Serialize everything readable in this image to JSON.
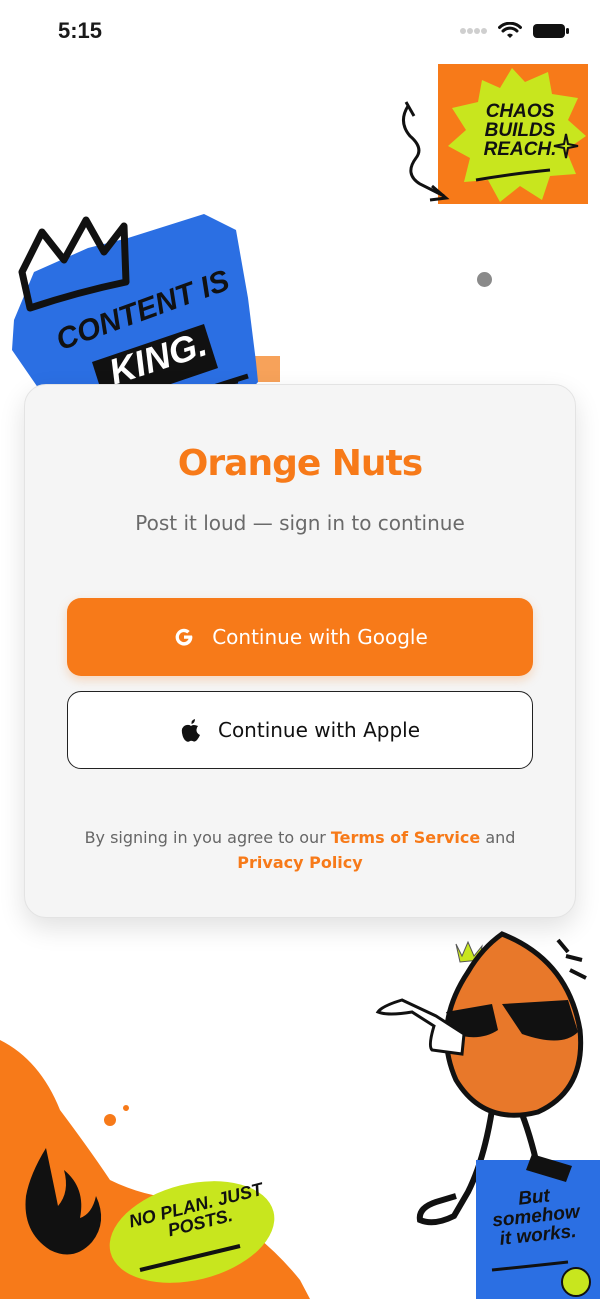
{
  "status_bar": {
    "time": "5:15"
  },
  "stickers": {
    "top_right": "CHAOS BUILDS REACH.",
    "top_left_line1": "CONTENT IS",
    "top_left_line2": "KING.",
    "bottom_left": "NO PLAN. JUST POSTS.",
    "bottom_right": "But somehow it works."
  },
  "card": {
    "brand": "Orange Nuts",
    "subtitle": "Post it loud — sign in to continue",
    "google_button": "Continue with Google",
    "apple_button": "Continue with Apple",
    "legal_prefix": "By signing in you agree to our",
    "terms_link": "Terms of Service",
    "legal_and": "and",
    "privacy_link": "Privacy Policy"
  },
  "colors": {
    "accent": "#f77a19",
    "blue": "#2b6fe3",
    "lime": "#c8e61e"
  }
}
